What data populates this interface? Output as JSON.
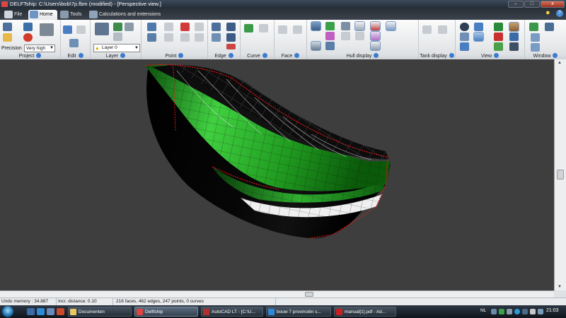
{
  "window": {
    "title": "DELFTship: C:\\Users\\bob\\7p.fbm (modified) - [Perspective view.]",
    "minimize": "–",
    "maximize": "□",
    "close": "x"
  },
  "tabs": [
    {
      "label": "File"
    },
    {
      "label": "Home"
    },
    {
      "label": "Tools"
    },
    {
      "label": "Calculations and extensions"
    }
  ],
  "ribbon": {
    "groups": [
      "Project",
      "Edit",
      "Layer",
      "Point",
      "Edge",
      "Curve",
      "Face",
      "Hull display",
      "Tank display",
      "View",
      "Window"
    ],
    "precision_label": "Precision",
    "precision_value": "Very high",
    "layer_value": "Layer 0"
  },
  "statusbar": {
    "undo_memory": "Undo memory : 34.887 Mb.",
    "incr_distance": "Incr. distance: 0.10",
    "model_info": "216 faces, 462 edges, 247 points, 0 curves"
  },
  "taskbar": {
    "items": [
      {
        "label": "Documenten"
      },
      {
        "label": "Delftship"
      },
      {
        "label": "AutoCAD LT - [C:\\U..."
      },
      {
        "label": "bouw 7 provinciën s..."
      },
      {
        "label": "manual[1].pdf - Ad..."
      }
    ],
    "language": "NL",
    "clock": "21:03"
  },
  "colors": {
    "viewport_bg": "#3e3e3e",
    "hull_green": "#1f9a1f",
    "hull_white": "#f2f2f2",
    "edge_red": "#e01818"
  }
}
